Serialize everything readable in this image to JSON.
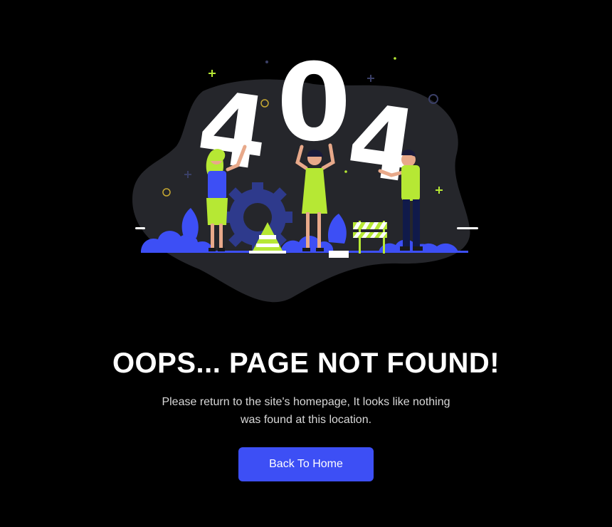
{
  "illustration": {
    "digits": [
      "4",
      "0",
      "4"
    ],
    "colors": {
      "blob": "#25262b",
      "blue": "#3d4ff5",
      "lime": "#b6e834",
      "navy": "#1d2b6b",
      "gear": "#2e3a8c",
      "skin": "#e8a98a",
      "white": "#ffffff"
    },
    "decorations": [
      "plus-icon",
      "ring-icon",
      "dot-icon"
    ]
  },
  "content": {
    "heading": "OOPS... PAGE NOT FOUND!",
    "message": "Please return to the site's homepage, It looks like nothing was found at this location.",
    "button_label": "Back To Home"
  },
  "theme": {
    "background": "#000000",
    "accent": "#3d4ff5",
    "text": "#ffffff",
    "muted_text": "#d8d8d8"
  }
}
